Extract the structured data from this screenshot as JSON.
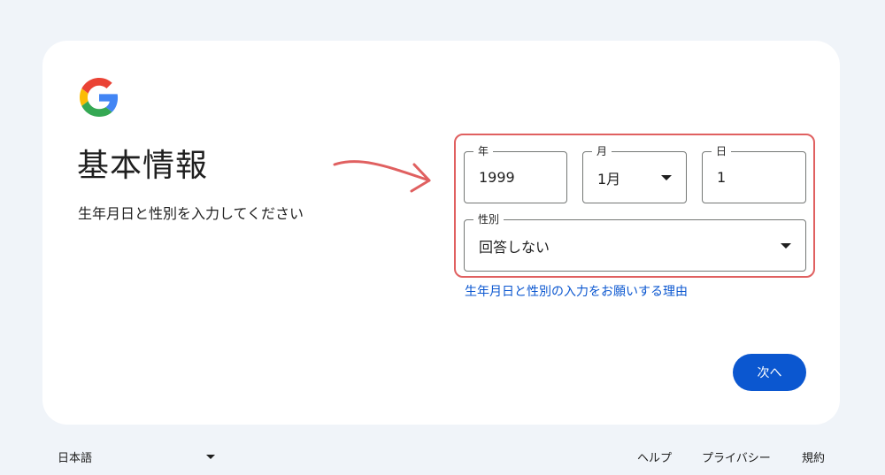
{
  "header": {
    "logo_icon": "google-g-logo-icon",
    "title": "基本情報",
    "subtitle": "生年月日と性別を入力してください"
  },
  "form": {
    "year": {
      "label": "年",
      "value": "1999"
    },
    "month": {
      "label": "月",
      "value": "1月",
      "icon": "dropdown-arrow-icon"
    },
    "day": {
      "label": "日",
      "value": "1"
    },
    "gender": {
      "label": "性別",
      "value": "回答しない",
      "icon": "dropdown-arrow-icon"
    },
    "reason_link": "生年月日と性別の入力をお願いする理由",
    "next_label": "次へ"
  },
  "footer": {
    "language": "日本語",
    "links": {
      "help": "ヘルプ",
      "privacy": "プライバシー",
      "terms": "規約"
    }
  },
  "colors": {
    "accent": "#0b57d0",
    "highlight": "#e06060",
    "background": "#f0f4f9",
    "card": "#ffffff"
  }
}
